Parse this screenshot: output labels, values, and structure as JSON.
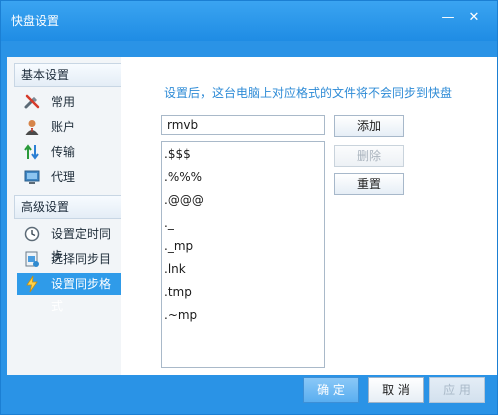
{
  "window": {
    "title": "快盘设置",
    "minimize_glyph": "—",
    "close_glyph": "✕"
  },
  "sidebar": {
    "basic_header": "基本设置",
    "basic_items": [
      {
        "label": "常用",
        "icon": "tools-icon"
      },
      {
        "label": "账户",
        "icon": "user-icon"
      },
      {
        "label": "传输",
        "icon": "transfer-arrows-icon"
      },
      {
        "label": "代理",
        "icon": "monitor-icon"
      }
    ],
    "advanced_header": "高级设置",
    "advanced_items": [
      {
        "label": "设置定时同步",
        "icon": "clock-icon"
      },
      {
        "label": "选择同步目录",
        "icon": "folder-icon"
      },
      {
        "label": "设置同步格式",
        "icon": "lightning-icon",
        "selected": true
      }
    ]
  },
  "content": {
    "hint": "设置后，这台电脑上对应格式的文件将不会同步到快盘",
    "input_value": "rmvb",
    "extensions": [
      ".$$$",
      ".%%%",
      ".@@@",
      "._",
      "._mp",
      ".lnk",
      ".tmp",
      ".~mp"
    ],
    "add_label": "添加",
    "delete_label": "删除",
    "reset_label": "重置"
  },
  "footer": {
    "ok_label": "确 定",
    "cancel_label": "取 消",
    "apply_label": "应 用"
  },
  "colors": {
    "accent": "#2a93e6",
    "selected": "#2f9be9",
    "hint_text": "#2e8bd6"
  }
}
